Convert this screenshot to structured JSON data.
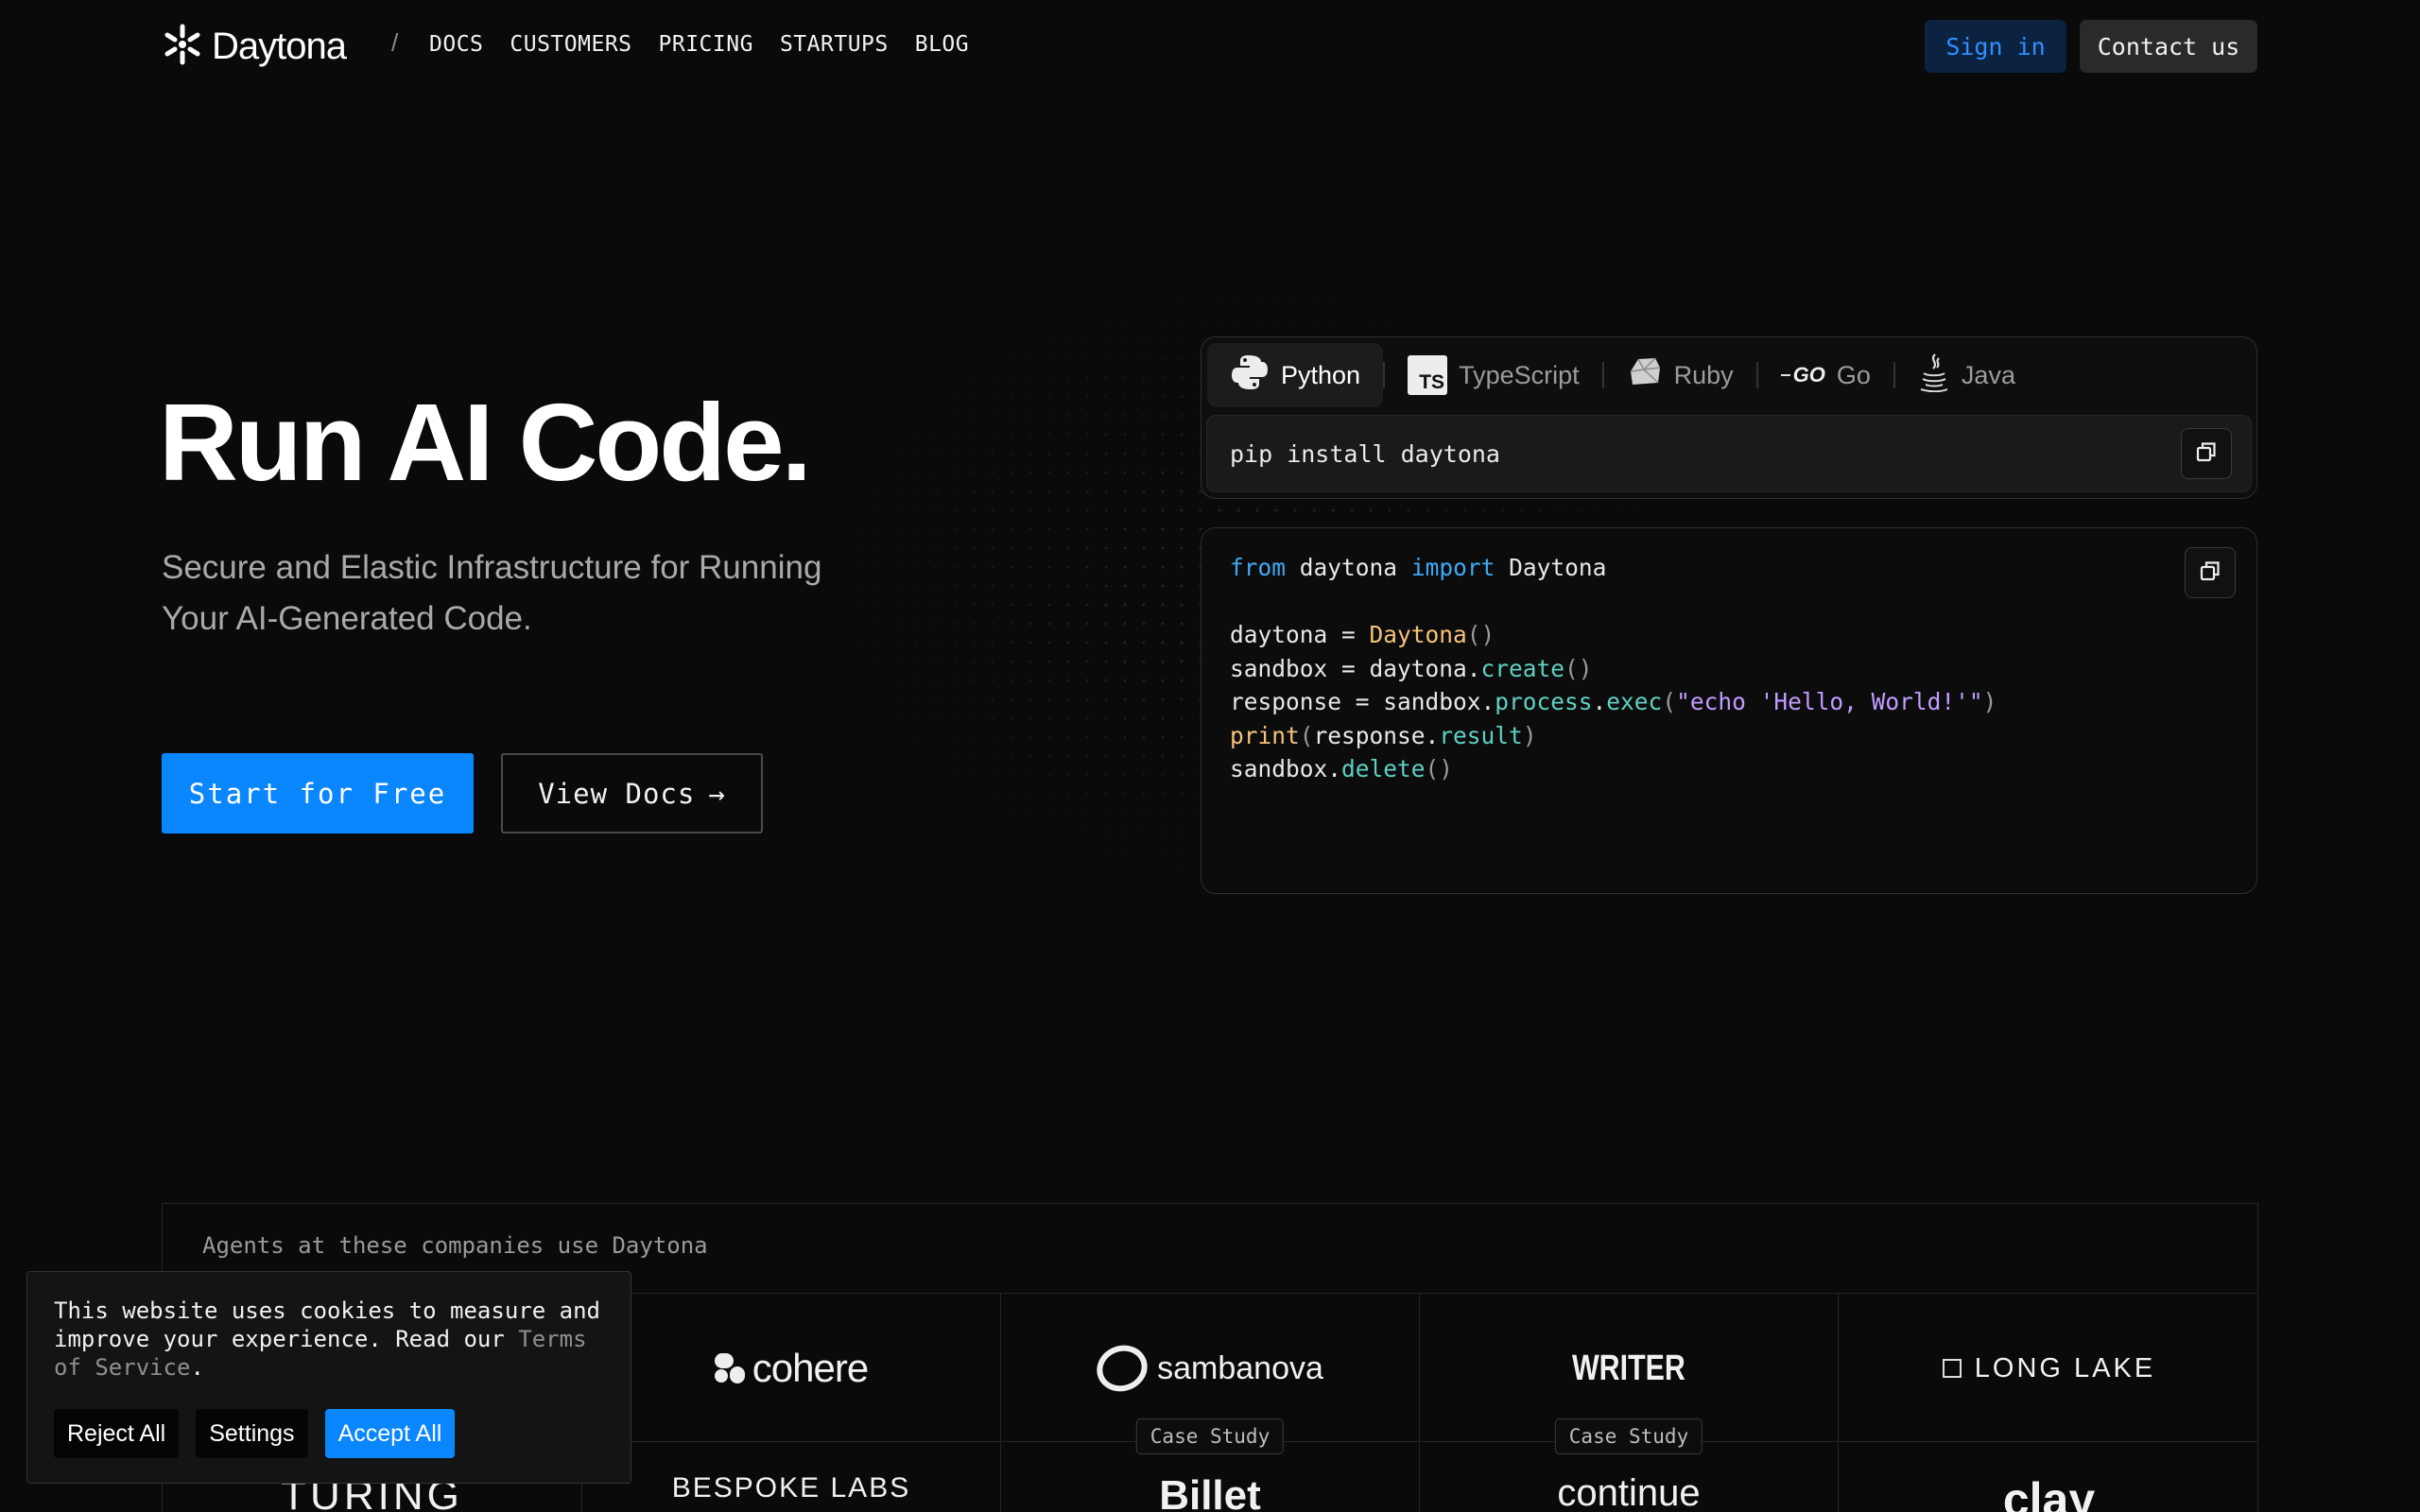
{
  "brand": {
    "name": "Daytona"
  },
  "nav": {
    "separator": "/",
    "links": [
      "DOCS",
      "CUSTOMERS",
      "PRICING",
      "STARTUPS",
      "BLOG"
    ],
    "sign_in": "Sign in",
    "contact": "Contact us"
  },
  "hero": {
    "title": "Run AI Code.",
    "subtitle": "Secure and Elastic Infrastructure for Running Your AI-Generated Code.",
    "start_button": "Start for Free",
    "docs_button": "View Docs",
    "docs_arrow": "→"
  },
  "install": {
    "tabs": [
      {
        "label": "Python",
        "icon": "python-icon",
        "active": true
      },
      {
        "label": "TypeScript",
        "icon": "typescript-icon",
        "active": false
      },
      {
        "label": "Ruby",
        "icon": "ruby-icon",
        "active": false
      },
      {
        "label": "Go",
        "icon": "go-icon",
        "active": false
      },
      {
        "label": "Java",
        "icon": "java-icon",
        "active": false
      }
    ],
    "ts_badge": "TS",
    "go_badge": "GO",
    "command": "pip install daytona"
  },
  "code": {
    "l1_from": "from",
    "l1_mod": "daytona",
    "l1_import": "import",
    "l1_cls": "Daytona",
    "l3_a": "daytona = ",
    "l3_cls": "Daytona",
    "l3_p": "()",
    "l4_a": "sandbox = daytona.",
    "l4_m": "create",
    "l4_p": "()",
    "l5_a": "response = sandbox.",
    "l5_m1": "process",
    "l5_dot": ".",
    "l5_m2": "exec",
    "l5_po": "(",
    "l5_s": "\"echo 'Hello, World!'\"",
    "l5_pc": ")",
    "l6_fn": "print",
    "l6_po": "(",
    "l6_a": "response.",
    "l6_m": "result",
    "l6_pc": ")",
    "l7_a": "sandbox.",
    "l7_m": "delete",
    "l7_p": "()"
  },
  "companies": {
    "heading": "Agents at these companies use Daytona",
    "row1": [
      "cohere",
      "sambanova",
      "WRITER",
      "LONG LAKE"
    ],
    "case_study": "Case Study",
    "row2": [
      "TURING",
      "BESPOKE LABS",
      "Billet",
      "continue",
      "clay"
    ]
  },
  "cookie": {
    "text": "This website uses cookies to measure and improve your experience. Read our ",
    "link": "Terms of Service",
    "period": ".",
    "reject": "Reject All",
    "settings": "Settings",
    "accept": "Accept All"
  },
  "colors": {
    "accent": "#0a86ff",
    "background": "#0a0a0b",
    "keyword": "#3fa9f5",
    "string": "#c29cff",
    "method": "#5fd0c3",
    "class": "#f7c27a"
  }
}
